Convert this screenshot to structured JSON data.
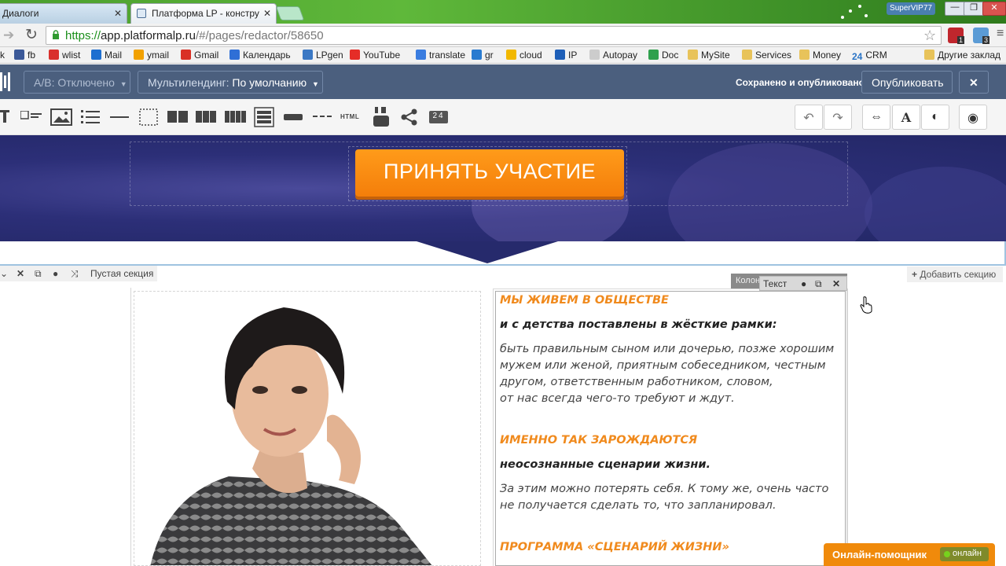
{
  "browser": {
    "tabs": [
      {
        "title": "Диалоги",
        "active": false
      },
      {
        "title": "Платформа LP - констру",
        "active": true
      }
    ],
    "profile_label": "SuperVIP77",
    "url": {
      "scheme": "https://",
      "host": "app.platformalp.ru",
      "path": "/#/pages/redactor/58650"
    },
    "extension_badges": [
      "1",
      "3"
    ],
    "bookmarks": [
      {
        "label": "k",
        "icon": "partial-icon",
        "color": "#777777"
      },
      {
        "label": "fb",
        "icon": "facebook-icon",
        "color": "#3b5998"
      },
      {
        "label": "wlist",
        "icon": "wlist-icon",
        "color": "#d9302c"
      },
      {
        "label": "Mail",
        "icon": "mail-at-icon",
        "color": "#1e6fd0"
      },
      {
        "label": "ymail",
        "icon": "ymail-icon",
        "color": "#f2a100"
      },
      {
        "label": "Gmail",
        "icon": "gmail-icon",
        "color": "#d93025"
      },
      {
        "label": "Календарь",
        "icon": "calendar-icon",
        "color": "#2f6fd6"
      },
      {
        "label": "LPgen",
        "icon": "lpgen-icon",
        "color": "#3b78c4"
      },
      {
        "label": "YouTube",
        "icon": "youtube-icon",
        "color": "#e52d27"
      },
      {
        "label": "translate",
        "icon": "translate-icon",
        "color": "#3a7de0"
      },
      {
        "label": "gr",
        "icon": "envelope-icon",
        "color": "#2a7bd0"
      },
      {
        "label": "cloud",
        "icon": "cloud-icon",
        "color": "#f2b800"
      },
      {
        "label": "IP",
        "icon": "ip-icon",
        "color": "#1e5fb8"
      },
      {
        "label": "Autopay",
        "icon": "page-icon",
        "color": "#cccccc"
      },
      {
        "label": "Doc",
        "icon": "drive-icon",
        "color": "#2fa04d"
      },
      {
        "label": "MySite",
        "icon": "folder-icon",
        "color": "#e8c35a"
      },
      {
        "label": "Services",
        "icon": "folder-icon",
        "color": "#e8c35a"
      },
      {
        "label": "Money",
        "icon": "folder-icon",
        "color": "#e8c35a"
      },
      {
        "label": "CRM",
        "icon": "crm24-icon",
        "color": "#2a74c6",
        "prefix": "24"
      },
      {
        "label": "Другие заклад",
        "icon": "folder-icon",
        "color": "#e8c35a"
      }
    ]
  },
  "editor": {
    "ab_label": "А/В: Отключено",
    "multilanding_prefix": "Мультилендинг:",
    "multilanding_value": "По умолчанию",
    "saved_status": "Сохранено и опубликовано",
    "publish_label": "Опубликовать",
    "close_symbol": "✕",
    "tools": [
      {
        "icon": "text-tool-icon"
      },
      {
        "icon": "image-text-tool-icon"
      },
      {
        "icon": "image-tool-icon"
      },
      {
        "icon": "list-tool-icon"
      },
      {
        "icon": "line-tool-icon"
      },
      {
        "icon": "empty-block-tool-icon"
      },
      {
        "icon": "two-columns-tool-icon"
      },
      {
        "icon": "three-columns-tool-icon"
      },
      {
        "icon": "four-columns-tool-icon"
      },
      {
        "icon": "form-tool-icon"
      },
      {
        "icon": "button-tool-icon"
      },
      {
        "icon": "divider-tool-icon"
      },
      {
        "icon": "html-tool-icon",
        "label": "HTML"
      },
      {
        "icon": "youtube-tool-icon"
      },
      {
        "icon": "share-tool-icon"
      },
      {
        "icon": "timer-tool-icon",
        "label": "24"
      }
    ],
    "right_tools": [
      {
        "icon": "undo-icon",
        "glyph": "↶"
      },
      {
        "icon": "redo-icon",
        "glyph": "↷"
      },
      {
        "icon": "width-icon",
        "glyph": "⇔"
      },
      {
        "icon": "font-icon",
        "glyph": "A"
      },
      {
        "icon": "contrast-icon",
        "glyph": "◐"
      },
      {
        "icon": "preview-eye-icon",
        "glyph": "◉"
      }
    ]
  },
  "hero": {
    "cta_label": "ПРИНЯТЬ УЧАСТИЕ",
    "accent": "#f47e0a"
  },
  "section": {
    "empty_label": "Пустая секция",
    "add_section_label": "Добавить секцию",
    "column_label": "Колон",
    "text_label": "Текст"
  },
  "content": {
    "paragraphs": [
      {
        "style": "orange",
        "text": "МЫ ЖИВЕМ В ОБЩЕСТВЕ"
      },
      {
        "style": "black",
        "text": "и с детства поставлены в жёсткие рамки:"
      },
      {
        "style": "normal",
        "text": "быть правильным сыном или дочерью, позже хорошим"
      },
      {
        "style": "normal",
        "text": "мужем или женой, приятным собеседником, честным"
      },
      {
        "style": "normal",
        "text": "другом, ответственным работником, словом,"
      },
      {
        "style": "normal",
        "text": "от нас всегда чего-то требуют и ждут."
      },
      {
        "style": "orange",
        "text": "ИМЕННО ТАК ЗАРОЖДАЮТСЯ"
      },
      {
        "style": "black",
        "text": "неосознанные сценарии жизни."
      },
      {
        "style": "normal",
        "text": "За этим можно потерять себя. К тому же, очень часто"
      },
      {
        "style": "normal",
        "text": "не получается сделать то, что запланировал."
      },
      {
        "style": "orange",
        "text": "ПРОГРАММА «СЦЕНАРИЙ ЖИЗНИ»"
      }
    ]
  },
  "chat": {
    "label": "Онлайн-помощник",
    "status": "онлайн",
    "color": "#f08a0b"
  }
}
